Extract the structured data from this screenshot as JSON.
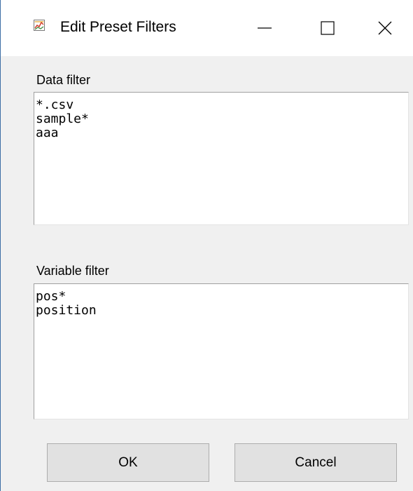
{
  "window": {
    "title": "Edit Preset Filters",
    "icon": "chart-app-icon",
    "controls": {
      "minimize_icon": "minimize-icon",
      "maximize_icon": "maximize-icon",
      "close_icon": "close-icon"
    }
  },
  "data_filter": {
    "label": "Data filter",
    "lines": [
      "*.csv",
      "sample*",
      "aaa"
    ]
  },
  "variable_filter": {
    "label": "Variable filter",
    "lines": [
      "pos*",
      "position"
    ]
  },
  "buttons": {
    "ok_label": "OK",
    "cancel_label": "Cancel"
  },
  "colors": {
    "titlebar_bg": "#ffffff",
    "dialog_bg": "#f0f0f0",
    "button_bg": "#e1e1e1",
    "button_border": "#adadad",
    "field_border": "#a0a0a0"
  }
}
